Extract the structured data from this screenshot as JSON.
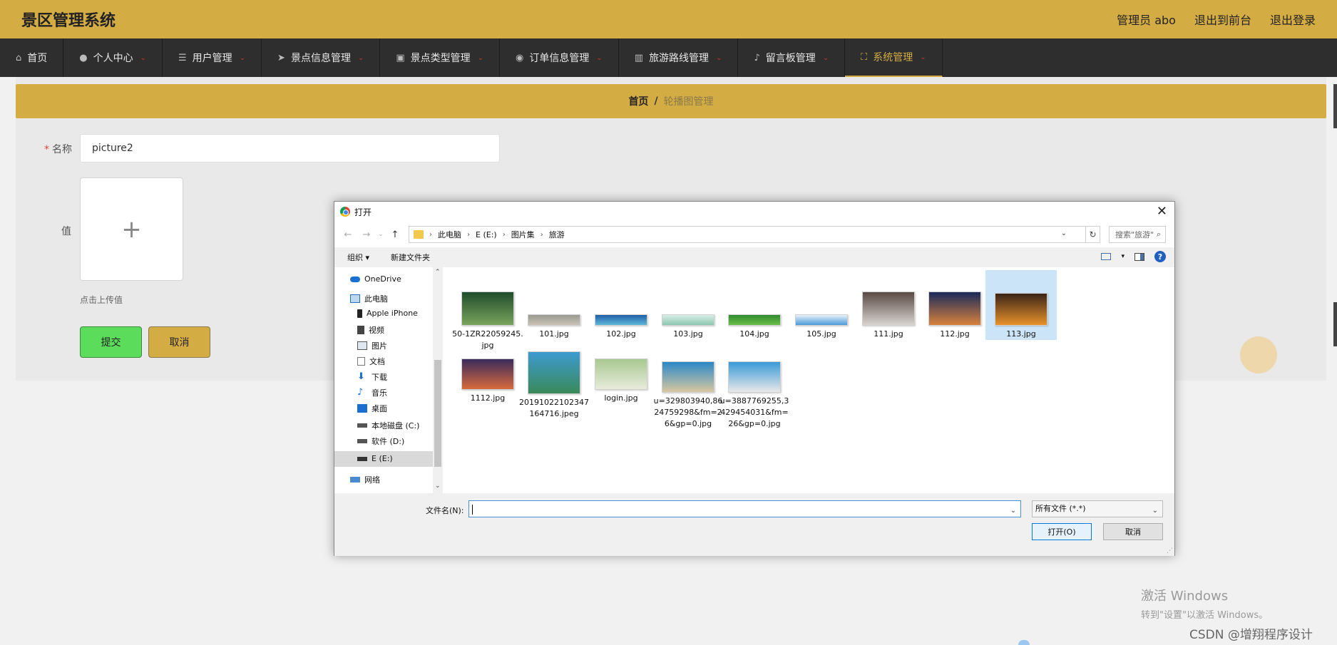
{
  "app": {
    "title": "景区管理系统",
    "links": [
      "管理员 abo",
      "退出到前台",
      "退出登录"
    ]
  },
  "nav": {
    "items": [
      {
        "label": "首页",
        "icon": "home-icon",
        "glyph": "⌂",
        "chev": ""
      },
      {
        "label": "个人中心",
        "icon": "user-icon",
        "glyph": "●",
        "chev": "⌄"
      },
      {
        "label": "用户管理",
        "icon": "list-icon",
        "glyph": "☰",
        "chev": "⌄"
      },
      {
        "label": "景点信息管理",
        "icon": "send-icon",
        "glyph": "➤",
        "chev": "⌄"
      },
      {
        "label": "景点类型管理",
        "icon": "printer-icon",
        "glyph": "▣",
        "chev": "⌄"
      },
      {
        "label": "订单信息管理",
        "icon": "location-icon",
        "glyph": "◉",
        "chev": "⌄"
      },
      {
        "label": "旅游路线管理",
        "icon": "chart-icon",
        "glyph": "▥",
        "chev": "⌄"
      },
      {
        "label": "留言板管理",
        "icon": "microphone-icon",
        "glyph": "♪",
        "chev": "⌄"
      },
      {
        "label": "系统管理",
        "icon": "fullscreen-icon",
        "glyph": "⛶",
        "chev": "⌄"
      }
    ]
  },
  "breadcrumb": {
    "home": "首页",
    "sep": "/",
    "current": "轮播图管理"
  },
  "form": {
    "required_mark": "*",
    "name_label": "名称",
    "name_value": "picture2",
    "value_label": "值",
    "upload_plus": "+",
    "upload_hint": "点击上传值",
    "submit": "提交",
    "cancel": "取消"
  },
  "dialog": {
    "title": "打开",
    "close": "✕",
    "nav": {
      "back": "←",
      "forward": "→",
      "recent": "⌄",
      "up": "↑"
    },
    "path": [
      "此电脑",
      "E (E:)",
      "图片集",
      "旅游"
    ],
    "path_sep": "›",
    "search_placeholder": "搜索\"旅游\"",
    "organize": "组织 ▾",
    "new_folder": "新建文件夹",
    "help": "?",
    "tree": [
      {
        "label": "OneDrive",
        "icon": "cloud-icon"
      },
      {
        "label": "此电脑",
        "icon": "computer-icon"
      },
      {
        "label": "Apple iPhone",
        "icon": "phone-icon"
      },
      {
        "label": "视频",
        "icon": "video-icon"
      },
      {
        "label": "图片",
        "icon": "pictures-icon"
      },
      {
        "label": "文档",
        "icon": "documents-icon"
      },
      {
        "label": "下载",
        "icon": "download-icon"
      },
      {
        "label": "音乐",
        "icon": "music-icon"
      },
      {
        "label": "桌面",
        "icon": "desktop-icon"
      },
      {
        "label": "本地磁盘 (C:)",
        "icon": "drive-icon"
      },
      {
        "label": "软件 (D:)",
        "icon": "drive-icon"
      },
      {
        "label": "E (E:)",
        "icon": "drive-icon"
      },
      {
        "label": "网络",
        "icon": "network-icon"
      }
    ],
    "files": [
      {
        "name": "50-1ZR22059245.jpg",
        "colors": [
          "#1f4d2c",
          "#7aa35c"
        ]
      },
      {
        "name": "101.jpg",
        "colors": [
          "#9a9a92",
          "#c9c3b4"
        ]
      },
      {
        "name": "102.jpg",
        "colors": [
          "#1f5fa8",
          "#5fb8d8"
        ]
      },
      {
        "name": "103.jpg",
        "colors": [
          "#d8eee8",
          "#8cc7b0"
        ]
      },
      {
        "name": "104.jpg",
        "colors": [
          "#2e8a2e",
          "#6bc04a"
        ]
      },
      {
        "name": "105.jpg",
        "colors": [
          "#e8f2fa",
          "#4a9ad8"
        ]
      },
      {
        "name": "111.jpg",
        "colors": [
          "#5a4a44",
          "#d8d4d0"
        ]
      },
      {
        "name": "112.jpg",
        "colors": [
          "#1a2a5c",
          "#d8823c"
        ]
      },
      {
        "name": "113.jpg",
        "colors": [
          "#3a2418",
          "#e8922a"
        ]
      },
      {
        "name": "1112.jpg",
        "colors": [
          "#3a2a5c",
          "#d86a3c"
        ]
      },
      {
        "name": "20191022102347164716.jpeg",
        "colors": [
          "#3c9ad0",
          "#3a8a5a"
        ]
      },
      {
        "name": "login.jpg",
        "colors": [
          "#a8c890",
          "#e8ecdc"
        ]
      },
      {
        "name": "u=329803940,8624759298&fm=26&gp=0.jpg",
        "colors": [
          "#2a88c8",
          "#d8c8a0"
        ]
      },
      {
        "name": "u=3887769255,3429454031&fm=26&gp=0.jpg",
        "colors": [
          "#3a9ad8",
          "#e8e8e8"
        ]
      }
    ],
    "filename_label": "文件名(N):",
    "filename_value": "",
    "filetype": "所有文件 (*.*)",
    "open": "打开(O)",
    "cancel": "取消"
  },
  "watermark": {
    "activate_title": "激活 Windows",
    "activate_sub": "转到\"设置\"以激活 Windows。",
    "csdn": "CSDN @增翔程序设计"
  }
}
